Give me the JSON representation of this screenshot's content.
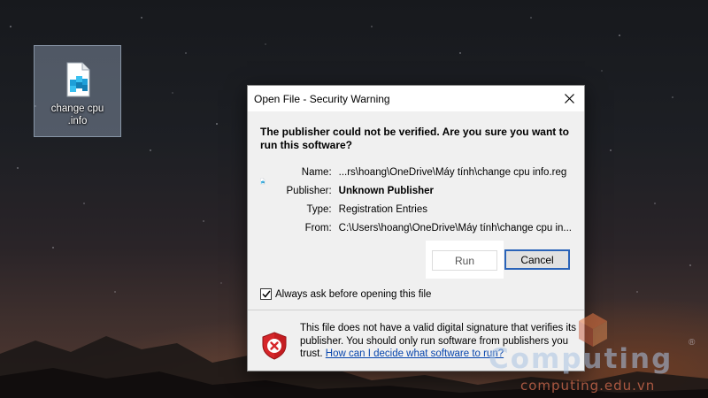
{
  "desktop": {
    "icon_label_line1": "change cpu",
    "icon_label_line2": ".info",
    "icon": "registry-file-icon"
  },
  "dialog": {
    "title": "Open File - Security Warning",
    "headline": "The publisher could not be verified.  Are you sure you want to run this software?",
    "file_icon": "registry-file-icon",
    "fields": [
      {
        "key": "Name:",
        "value": "...rs\\hoang\\OneDrive\\Máy tính\\change cpu info.reg"
      },
      {
        "key": "Publisher:",
        "value": "Unknown Publisher"
      },
      {
        "key": "Type:",
        "value": "Registration Entries"
      },
      {
        "key": "From:",
        "value": "C:\\Users\\hoang\\OneDrive\\Máy tính\\change cpu in..."
      }
    ],
    "run_label": "Run",
    "cancel_label": "Cancel",
    "checkbox_label": "Always ask before opening this file",
    "checkbox_checked": true,
    "warning_text": "This file does not have a valid digital signature that verifies its publisher.  You should only run software from publishers you trust.",
    "warning_link": "How can I decide what software to run?",
    "shield_icon": "security-shield-error-icon"
  },
  "watermark": {
    "brand": "Computing",
    "registered": "®",
    "url": "computing.edu.vn"
  },
  "colors": {
    "dialog_bg": "#f0f0f0",
    "focus_border": "#2a63b8",
    "link": "#0645ad",
    "shield_red": "#d6262a"
  }
}
